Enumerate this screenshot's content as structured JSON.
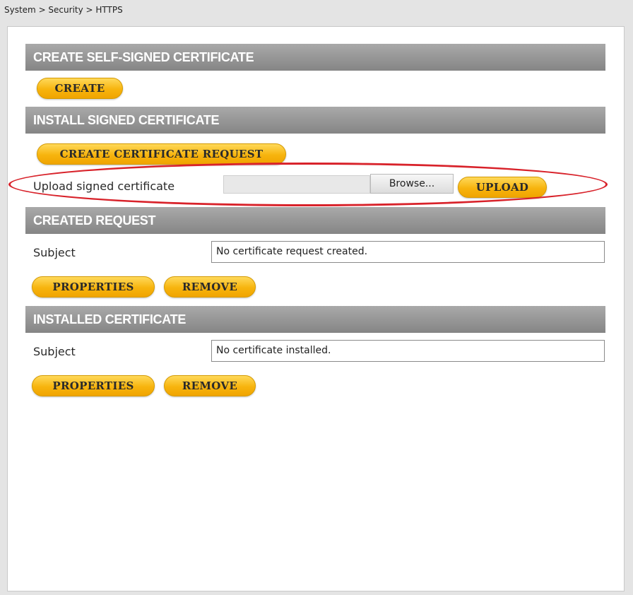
{
  "breadcrumb": "System > Security > HTTPS",
  "sections": {
    "self_signed": {
      "header": "CREATE SELF-SIGNED CERTIFICATE",
      "create_button": "CREATE"
    },
    "install_signed": {
      "header": "INSTALL SIGNED CERTIFICATE",
      "request_button": "CREATE CERTIFICATE REQUEST",
      "upload_label": "Upload signed certificate",
      "browse_button": "Browse...",
      "upload_button": "UPLOAD"
    },
    "created_request": {
      "header": "CREATED REQUEST",
      "subject_label": "Subject",
      "subject_value": "No certificate request created.",
      "properties_button": "PROPERTIES",
      "remove_button": "REMOVE"
    },
    "installed_certificate": {
      "header": "INSTALLED CERTIFICATE",
      "subject_label": "Subject",
      "subject_value": "No certificate installed.",
      "properties_button": "PROPERTIES",
      "remove_button": "REMOVE"
    }
  },
  "colors": {
    "button_gold": "#f7b40e",
    "header_gray": "#959595",
    "highlight_red": "#d8222a"
  }
}
